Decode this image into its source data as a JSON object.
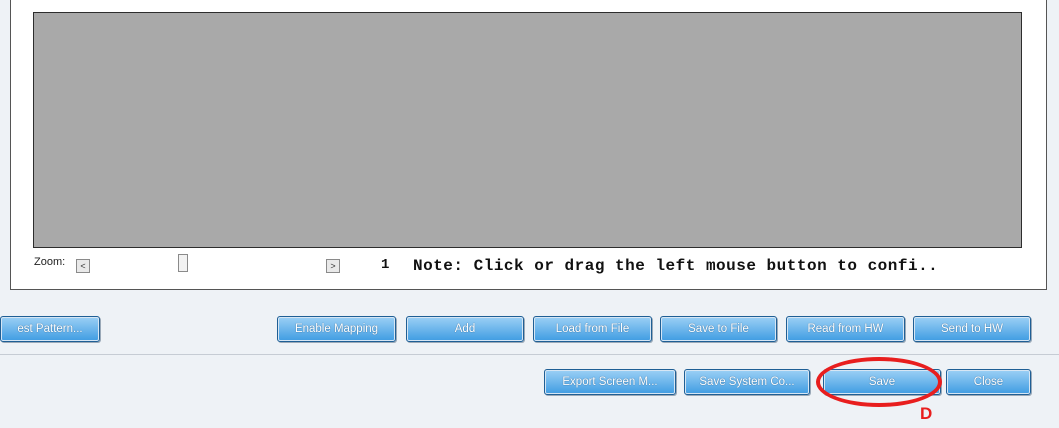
{
  "viewer": {
    "zoom_label": "Zoom:",
    "scroll_left": "<",
    "scroll_right": ">",
    "zoom_value": "1",
    "note": "Note: Click or drag the left mouse button to confi.."
  },
  "toolbar_row1": {
    "test_pattern": "est Pattern...",
    "enable_mapping": "Enable Mapping",
    "add": "Add",
    "load_from_file": "Load from File",
    "save_to_file": "Save to File",
    "read_from_hw": "Read from HW",
    "send_to_hw": "Send to HW"
  },
  "toolbar_row2": {
    "export_screen": "Export Screen M...",
    "save_system_config": "Save System Co...",
    "save": "Save",
    "close": "Close"
  },
  "annotation": {
    "letter": "D",
    "color": "#e81e1e"
  },
  "colors": {
    "button_top": "#9cd0f5",
    "button_bottom": "#3f9ce2",
    "canvas": "#a9a9a9"
  }
}
